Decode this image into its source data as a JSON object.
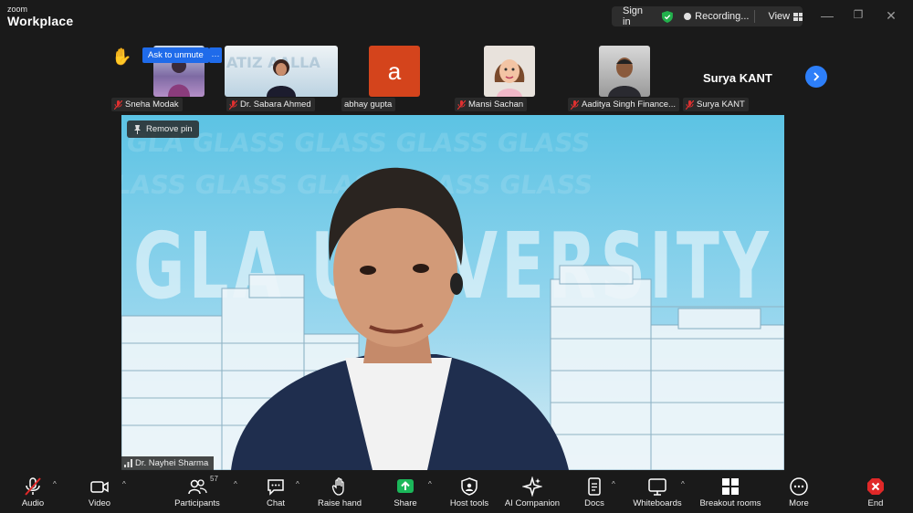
{
  "app": {
    "brand_small": "zoom",
    "brand_big": "Workplace"
  },
  "titlebar": {
    "sign_in": "Sign in",
    "recording": "Recording...",
    "view": "View"
  },
  "strip": {
    "ask_to_unmute": "Ask to unmute",
    "more": "···",
    "participants": [
      {
        "name": "Sneha Modak"
      },
      {
        "name": "Dr. Sabara Ahmed"
      },
      {
        "name": "abhay gupta",
        "avatar_letter": "a"
      },
      {
        "name": "Mansi Sachan"
      },
      {
        "name": "Aaditya Singh Finance..."
      },
      {
        "name": "Surya KANT"
      }
    ],
    "featured_name": "Surya KANT"
  },
  "video": {
    "remove_pin": "Remove pin",
    "speaker": "Dr. Nayhei Sharma",
    "backdrop_text": "GLA UNIVERSITY"
  },
  "toolbar": {
    "audio": "Audio",
    "video": "Video",
    "participants": "Participants",
    "participants_count": "57",
    "chat": "Chat",
    "raise_hand": "Raise hand",
    "share": "Share",
    "host_tools": "Host tools",
    "ai_companion": "AI Companion",
    "docs": "Docs",
    "whiteboards": "Whiteboards",
    "breakout_rooms": "Breakout rooms",
    "more": "More",
    "end": "End"
  },
  "colors": {
    "accent": "#1f6bea",
    "share": "#1bb75a",
    "end": "#e02828",
    "backdrop": "#7fd0ea"
  }
}
